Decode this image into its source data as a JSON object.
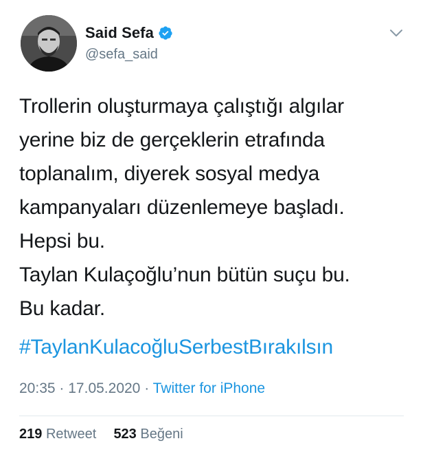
{
  "author": {
    "display_name": "Said Sefa",
    "handle": "@sefa_said",
    "verified_icon": "verified-badge-icon",
    "avatar_icon": "avatar"
  },
  "menu_icon": "chevron-down-icon",
  "tweet": {
    "lines": [
      "Trollerin oluşturmaya çalıştığı algılar",
      "yerine biz de gerçeklerin etrafında",
      "toplanalım, diyerek sosyal medya",
      "kampanyaları düzenlemeye başladı.",
      "Hepsi bu.",
      "Taylan Kulaçoğlu’nun bütün suçu bu.",
      "Bu kadar."
    ],
    "hashtag": "#TaylanKulacoğluSerbestBırakılsın",
    "time": "20:35",
    "separator": "·",
    "date": "17.05.2020",
    "source": "Twitter for iPhone"
  },
  "stats": {
    "retweet_count": "219",
    "retweet_label": "Retweet",
    "like_count": "523",
    "like_label": "Beğeni"
  },
  "colors": {
    "link": "#1b95e0",
    "secondary_text": "#657786",
    "primary_text": "#14171a",
    "divider": "#e1e8ed"
  }
}
